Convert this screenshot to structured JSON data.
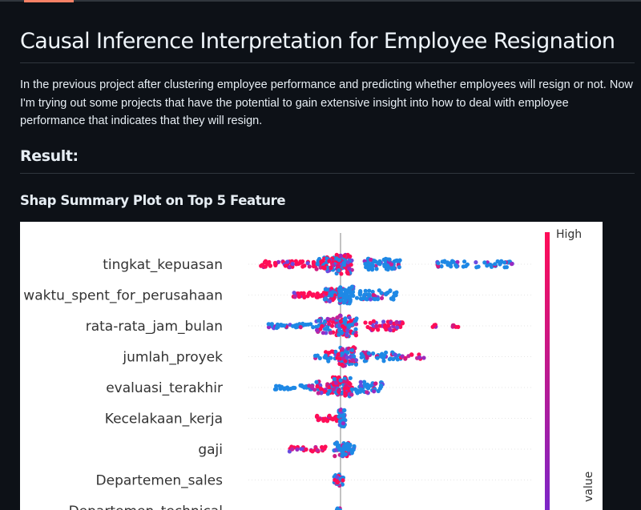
{
  "page": {
    "title": "Causal Inference Interpretation for Employee Resignation",
    "intro": "In the previous project after clustering employee performance and predicting whether employees will resign or not. Now I'm trying out some projects that have the potential to gain extensive insight into how to deal with employee performance that indicates that they will resign.",
    "result_heading": "Result:",
    "plot_heading": "Shap Summary Plot on Top 5 Feature"
  },
  "chart_data": {
    "type": "scatter",
    "title": "",
    "features": [
      "tingkat_kepuasan",
      "waktu_spent_for_perusahaan",
      "rata-rata_jam_bulan",
      "jumlah_proyek",
      "evaluasi_terakhir",
      "Kecelakaan_kerja",
      "gaji",
      "Departemen_sales",
      "Departemen_technical"
    ],
    "colorbar": {
      "high_label": "High",
      "label": "value",
      "high_color": "#ff0d57",
      "low_color": "#1e88e5"
    },
    "zero_line": 0
  }
}
